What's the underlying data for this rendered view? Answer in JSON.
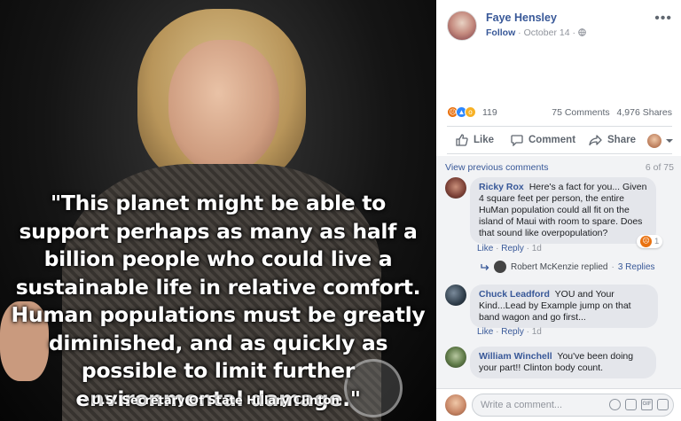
{
  "photo": {
    "quote": "\"This planet might be able to support perhaps as many as half a billion people who could live a sustainable life in relative comfort. Human populations must be greatly diminished, and as quickly as possible to limit further environmental damage.\"",
    "attribution": "- U.S. Secretary Of State Hillary Clinton"
  },
  "post": {
    "author": "Faye Hensley",
    "follow": "Follow",
    "date": "October 14",
    "separator": "·",
    "more_icon": "more-icon"
  },
  "reactions": {
    "count": "119",
    "comments": "75 Comments",
    "shares": "4,976 Shares"
  },
  "actions": {
    "like": "Like",
    "comment": "Comment",
    "share": "Share"
  },
  "comments_section": {
    "view_previous": "View previous comments",
    "page_count": "6 of 75",
    "items": [
      {
        "name": "Ricky Rox",
        "text": "Here's a fact for you... Given 4 square feet per person, the entire HuMan population could all fit on the island of Maui with room to spare. Does that sound like overpopulation?",
        "like": "Like",
        "reply": "Reply",
        "time": "1d",
        "reaction_count": "1"
      },
      {
        "name": "Chuck Leadford",
        "text": "YOU and Your Kind...Lead by Example jump on that band wagon and go first...",
        "like": "Like",
        "reply": "Reply",
        "time": "1d"
      },
      {
        "name": "William Winchell",
        "text": "You've been doing your part!! Clinton body count."
      }
    ],
    "reply_summary": {
      "text": "Robert McKenzie replied",
      "replies": "3 Replies"
    }
  },
  "composer": {
    "placeholder": "Write a comment...",
    "gif_label": "GIF"
  },
  "colors": {
    "link": "#385898",
    "muted": "#90949c",
    "comment_bg": "#f2f3f5",
    "bubble": "#e4e6eb"
  }
}
